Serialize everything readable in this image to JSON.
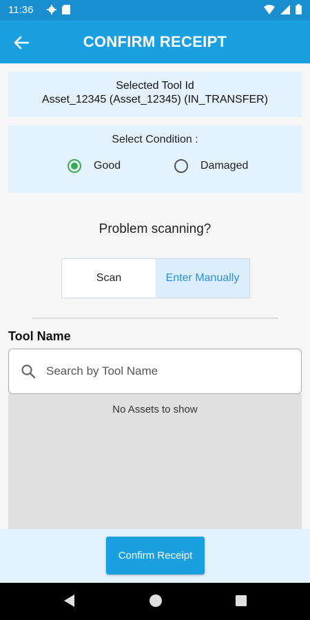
{
  "status_bar": {
    "time": "11:36"
  },
  "header": {
    "title": "CONFIRM RECEIPT"
  },
  "selected_tool": {
    "label": "Selected Tool Id",
    "value": "Asset_12345 (Asset_12345) (IN_TRANSFER)"
  },
  "condition": {
    "title": "Select Condition :",
    "options": [
      {
        "label": "Good",
        "selected": true
      },
      {
        "label": "Damaged",
        "selected": false
      }
    ]
  },
  "scan": {
    "problem_text": "Problem scanning?",
    "toggle": [
      {
        "label": "Scan",
        "active": false
      },
      {
        "label": "Enter Manually",
        "active": true
      }
    ]
  },
  "tool_name": {
    "label": "Tool Name",
    "search_placeholder": "Search by Tool Name",
    "search_value": ""
  },
  "asset_list": {
    "empty_message": "No Assets to show"
  },
  "footer": {
    "confirm_label": "Confirm Receipt"
  },
  "colors": {
    "primary": "#1a9fe0",
    "status_bar": "#1a8fcf",
    "card_bg": "#e3f2fc",
    "radio_selected": "#3daa4e",
    "link": "#2a8fd6"
  }
}
